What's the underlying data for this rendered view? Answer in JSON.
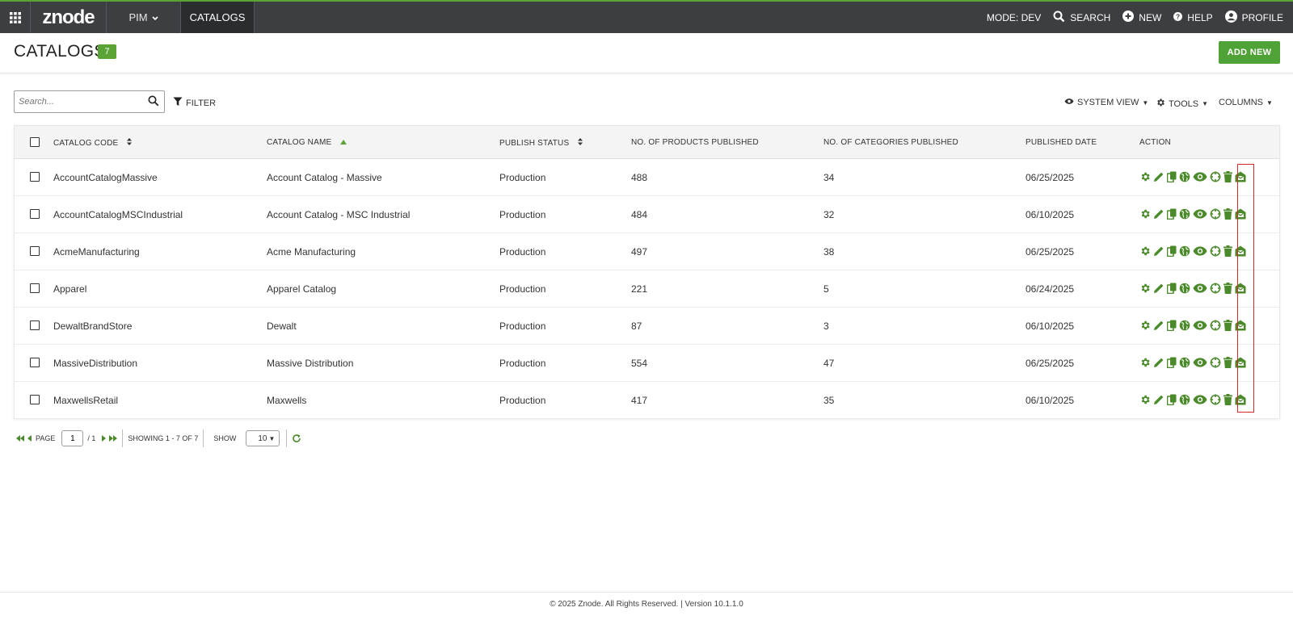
{
  "topbar": {
    "logo": "znode",
    "menu_label": "PIM",
    "active_tab": "CATALOGS",
    "mode": "MODE: DEV",
    "search": "SEARCH",
    "new": "NEW",
    "help": "HELP",
    "profile": "PROFILE"
  },
  "header": {
    "title": "CATALOGS",
    "count": "7",
    "add_new": "ADD NEW"
  },
  "toolbar": {
    "search_placeholder": "Search...",
    "filter": "FILTER",
    "system_view": "SYSTEM VIEW",
    "tools": "TOOLS",
    "columns": "COLUMNS"
  },
  "table": {
    "columns": [
      "CATALOG CODE",
      "CATALOG NAME",
      "PUBLISH STATUS",
      "NO. OF PRODUCTS PUBLISHED",
      "NO. OF CATEGORIES PUBLISHED",
      "PUBLISHED DATE",
      "ACTION"
    ],
    "rows": [
      {
        "code": "AccountCatalogMassive",
        "name": "Account Catalog - Massive",
        "status": "Production",
        "products": "488",
        "categories": "34",
        "date": "06/25/2025"
      },
      {
        "code": "AccountCatalogMSCIndustrial",
        "name": "Account Catalog - MSC Industrial",
        "status": "Production",
        "products": "484",
        "categories": "32",
        "date": "06/10/2025"
      },
      {
        "code": "AcmeManufacturing",
        "name": "Acme Manufacturing",
        "status": "Production",
        "products": "497",
        "categories": "38",
        "date": "06/25/2025"
      },
      {
        "code": "Apparel",
        "name": "Apparel Catalog",
        "status": "Production",
        "products": "221",
        "categories": "5",
        "date": "06/24/2025"
      },
      {
        "code": "DewaltBrandStore",
        "name": "Dewalt",
        "status": "Production",
        "products": "87",
        "categories": "3",
        "date": "06/10/2025"
      },
      {
        "code": "MassiveDistribution",
        "name": "Massive Distribution",
        "status": "Production",
        "products": "554",
        "categories": "47",
        "date": "06/25/2025"
      },
      {
        "code": "MaxwellsRetail",
        "name": "Maxwells",
        "status": "Production",
        "products": "417",
        "categories": "35",
        "date": "06/10/2025"
      }
    ],
    "action_icons": [
      "settings-icon",
      "edit-icon",
      "copy-icon",
      "publish-globe-icon",
      "preview-eye-icon",
      "target-icon",
      "delete-icon",
      "store-access-icon"
    ],
    "action_color": "#4a8a2a"
  },
  "pager": {
    "page_label": "PAGE",
    "page_value": "1",
    "page_total": "/ 1",
    "showing": "SHOWING 1 - 7 OF 7",
    "show_label": "SHOW",
    "page_size": "10"
  },
  "footer": {
    "text": "© 2025 Znode. All Rights Reserved. | Version 10.1.1.0"
  },
  "colors": {
    "brand_green": "#5aa436",
    "topbar_bg": "#3d3e42",
    "highlight": "#d22a2a"
  }
}
